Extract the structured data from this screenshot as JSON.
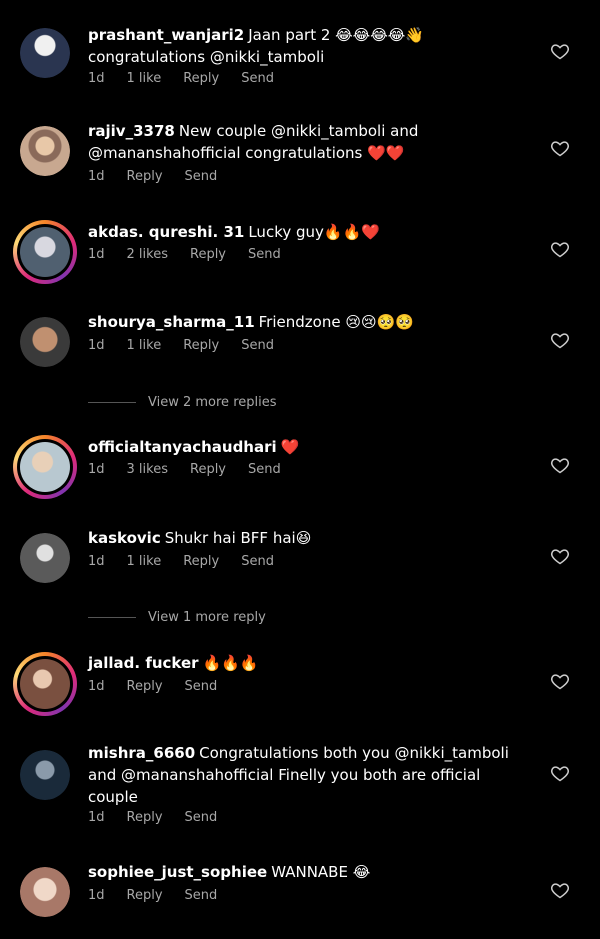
{
  "comments": [
    {
      "username": "prashant_wanjari2",
      "text_html": "Jaan part 2 😂😂😂😂👋",
      "line2": "congratulations @nikki_tamboli",
      "time": "1d",
      "likes": "1 like",
      "reply": "Reply",
      "send": "Send",
      "avatar_color": "#5a6b8a"
    },
    {
      "username": "rajiv_3378",
      "text": "New  couple @nikki_tamboli  and",
      "line2": "@mananshahofficial  congratulations ❤️❤️",
      "time": "1d",
      "reply": "Reply",
      "send": "Send",
      "avatar_color": "#c89a7a"
    },
    {
      "username": "akdas. qureshi. 31",
      "text": "Lucky guy🔥🔥❤️",
      "time": "1d",
      "likes": "2 likes",
      "reply": "Reply",
      "send": "Send",
      "avatar_color": "#7a8a96"
    },
    {
      "username": "shourya_sharma_11",
      "text": "Friendzone 😢😢🥺🥺",
      "time": "1d",
      "likes": "1 like",
      "reply": "Reply",
      "send": "Send",
      "avatar_color": "#5a5048"
    },
    {
      "username": "officialtanyachaudhari",
      "text": "❤️",
      "time": "1d",
      "likes": "3 likes",
      "reply": "Reply",
      "send": "Send",
      "avatar_color": "#c8b098"
    },
    {
      "username": "kaskovic",
      "text": "Shukr hai BFF hai😆",
      "time": "1d",
      "likes": "1 like",
      "reply": "Reply",
      "send": "Send",
      "avatar_color": "#6a6a6a"
    },
    {
      "username": "jallad. fucker",
      "text": "🔥🔥🔥",
      "time": "1d",
      "reply": "Reply",
      "send": "Send",
      "avatar_color": "#9a6a5a"
    },
    {
      "username": "mishra_6660",
      "text": "Congratulations both you @nikki_tamboli",
      "line2": "and @mananshahofficial Finelly you both are official",
      "line3": "couple",
      "time": "1d",
      "reply": "Reply",
      "send": "Send",
      "avatar_color": "#3a4a5a"
    },
    {
      "username": "sophiee_just_sophiee",
      "text": "WANNABE 😂",
      "time": "1d",
      "reply": "Reply",
      "send": "Send",
      "avatar_color": "#d8b8a8"
    }
  ],
  "view_replies_1": "View 2 more replies",
  "view_replies_2": "View 1 more reply"
}
